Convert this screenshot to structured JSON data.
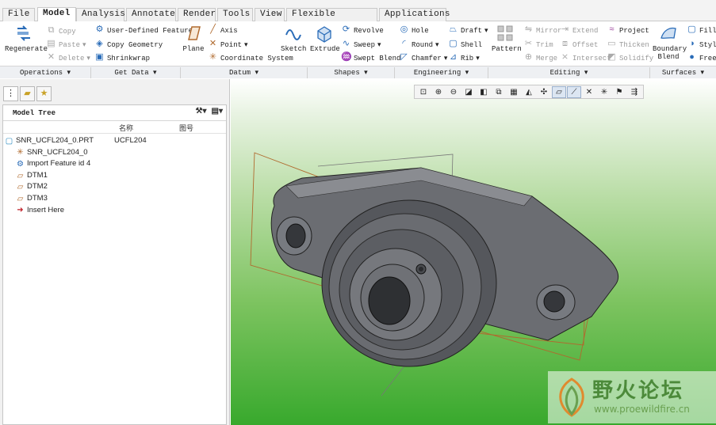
{
  "menu": {
    "tabs": [
      "File",
      "Model",
      "Analysis",
      "Annotate",
      "Render",
      "Tools",
      "View",
      "Flexible Modeling",
      "Applications"
    ],
    "file_arrow": "▾"
  },
  "ribbon": {
    "operations": {
      "regenerate": "Regenerate",
      "copy": "Copy",
      "paste": "Paste",
      "delete": "Delete"
    },
    "getdata": {
      "udf": "User-Defined Feature",
      "copy_geometry": "Copy Geometry",
      "shrinkwrap": "Shrinkwrap"
    },
    "datum": {
      "plane": "Plane",
      "axis": "Axis",
      "point": "Point",
      "csys": "Coordinate System",
      "sketch": "Sketch"
    },
    "shapes": {
      "extrude": "Extrude",
      "revolve": "Revolve",
      "sweep": "Sweep",
      "swept_blend": "Swept Blend"
    },
    "engineering": {
      "hole": "Hole",
      "round": "Round",
      "chamfer": "Chamfer",
      "draft": "Draft",
      "shell": "Shell",
      "rib": "Rib"
    },
    "editing": {
      "pattern": "Pattern",
      "mirror": "Mirror",
      "trim": "Trim",
      "merge": "Merge",
      "extend": "Extend",
      "offset": "Offset",
      "intersect": "Intersect",
      "project": "Project",
      "thicken": "Thicken",
      "solidify": "Solidify"
    },
    "surfaces": {
      "boundary_blend_1": "Boundary",
      "boundary_blend_2": "Blend",
      "fill": "Fill",
      "style": "Style",
      "freestyle": "Frees"
    }
  },
  "groups": [
    "Operations",
    "Get Data",
    "Datum",
    "Shapes",
    "Engineering",
    "Editing",
    "Surfaces"
  ],
  "tree": {
    "title": "Model Tree",
    "col_name": "名称",
    "col_number": "图号",
    "rows": [
      {
        "label": "SNR_UCFL204_0.PRT",
        "value": "UCFL204",
        "icon": "part-icon"
      },
      {
        "label": "SNR_UCFL204_0",
        "value": "",
        "icon": "csys-icon"
      },
      {
        "label": "Import Feature id 4",
        "value": "",
        "icon": "import-feature-icon"
      },
      {
        "label": "DTM1",
        "value": "",
        "icon": "datum-plane-icon"
      },
      {
        "label": "DTM2",
        "value": "",
        "icon": "datum-plane-icon"
      },
      {
        "label": "DTM3",
        "value": "",
        "icon": "datum-plane-icon"
      },
      {
        "label": "Insert Here",
        "value": "",
        "icon": "insert-here-icon"
      }
    ]
  },
  "watermark": {
    "text": "野火论坛",
    "url": "www.proewildfire.cn"
  },
  "colors": {
    "viewport_top": "#ffffff",
    "viewport_bottom": "#38a92d",
    "part": "#6b6d72",
    "datum": "#b06a2e"
  }
}
